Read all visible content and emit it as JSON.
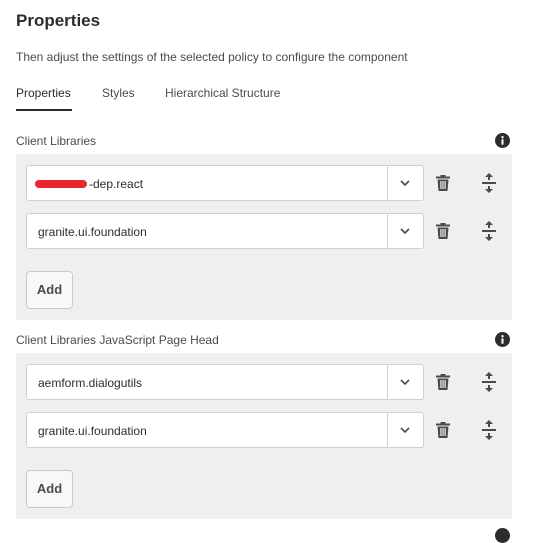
{
  "header": {
    "title": "Properties",
    "subtitle": "Then adjust the settings of the selected policy to configure the component"
  },
  "tabs": [
    {
      "label": "Properties",
      "active": true
    },
    {
      "label": "Styles",
      "active": false
    },
    {
      "label": "Hierarchical Structure",
      "active": false
    }
  ],
  "sections": [
    {
      "label": "Client Libraries",
      "items": [
        {
          "value": "-dep.react",
          "redacted_prefix": true
        },
        {
          "value": "granite.ui.foundation"
        }
      ],
      "add_label": "Add"
    },
    {
      "label": "Client Libraries JavaScript Page Head",
      "items": [
        {
          "value": "aemform.dialogutils"
        },
        {
          "value": "granite.ui.foundation"
        }
      ],
      "add_label": "Add"
    }
  ],
  "icons": {
    "info": "info-icon",
    "dropdown": "chevron-down-icon",
    "delete": "trash-icon",
    "reorder": "move-vertical-icon"
  },
  "colors": {
    "panel_background": "#efefef",
    "redaction": "#e8282e",
    "text": "#2c2c2c"
  }
}
